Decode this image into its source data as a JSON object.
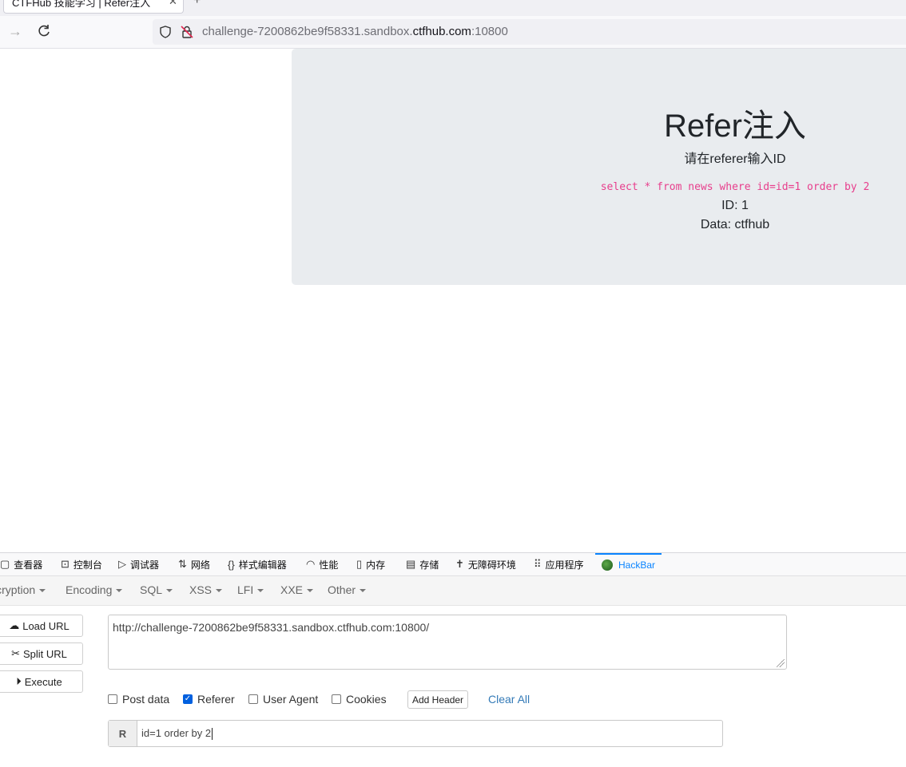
{
  "browser": {
    "tab_title": "CTFHub 技能学习 | Refer注入",
    "tab_close_glyph": "✕",
    "new_tab_glyph": "+",
    "url_prefix": "challenge-7200862be9f58331.sandbox.",
    "url_domain": "ctfhub.com",
    "url_suffix": ":10800"
  },
  "page": {
    "title": "Refer注入",
    "subtitle": "请在referer输入ID",
    "query": "select * from news where id=id=1 order by 2",
    "result_id": "ID: 1",
    "result_data": "Data: ctfhub"
  },
  "devtools": {
    "tabs": [
      {
        "icon": "inspector-icon",
        "glyph": "▢",
        "label": "查看器"
      },
      {
        "icon": "console-icon",
        "glyph": "⊡",
        "label": "控制台"
      },
      {
        "icon": "debugger-icon",
        "glyph": "▷",
        "label": "调试器"
      },
      {
        "icon": "network-icon",
        "glyph": "⇅",
        "label": "网络"
      },
      {
        "icon": "style-editor-icon",
        "glyph": "{}",
        "label": "样式编辑器"
      },
      {
        "icon": "performance-icon",
        "glyph": "◠",
        "label": "性能"
      },
      {
        "icon": "memory-icon",
        "glyph": "▯",
        "label": "内存"
      },
      {
        "icon": "storage-icon",
        "glyph": "▤",
        "label": "存储"
      },
      {
        "icon": "accessibility-icon",
        "glyph": "✝",
        "label": "无障碍环境"
      },
      {
        "icon": "application-icon",
        "glyph": "⠿",
        "label": "应用程序"
      }
    ],
    "hackbar_tab": "HackBar"
  },
  "hackbar": {
    "menu": [
      "Encryption",
      "Encoding",
      "SQL",
      "XSS",
      "LFI",
      "XXE",
      "Other"
    ],
    "load_url": "Load URL",
    "split_url": "Split URL",
    "execute": "Execute",
    "url_value": "http://challenge-7200862be9f58331.sandbox.ctfhub.com:10800/",
    "options": [
      {
        "label": "Post data",
        "checked": false
      },
      {
        "label": "Referer",
        "checked": true
      },
      {
        "label": "User Agent",
        "checked": false
      },
      {
        "label": "Cookies",
        "checked": false
      }
    ],
    "add_header": "Add Header",
    "clear_all": "Clear All",
    "referer_label": "R",
    "referer_value": "id=1 order by 2"
  }
}
